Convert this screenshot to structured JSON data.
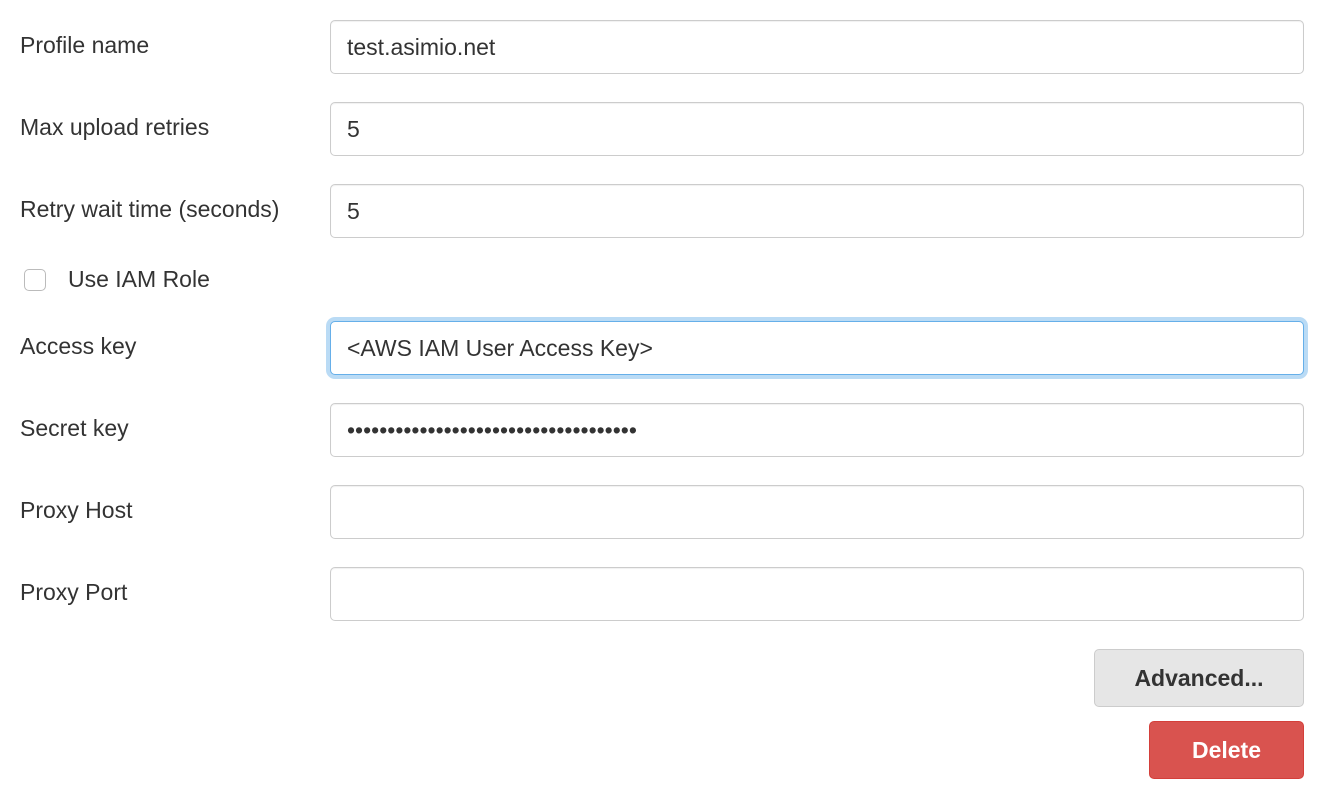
{
  "form": {
    "profile_name": {
      "label": "Profile name",
      "value": "test.asimio.net"
    },
    "max_upload_retries": {
      "label": "Max upload retries",
      "value": "5"
    },
    "retry_wait_time": {
      "label": "Retry wait time (seconds)",
      "value": "5"
    },
    "use_iam_role": {
      "label": "Use IAM Role",
      "checked": false
    },
    "access_key": {
      "label": "Access key",
      "value": "<AWS IAM User Access Key>"
    },
    "secret_key": {
      "label": "Secret key",
      "value": "••••••••••••••••••••••••••••••••••••"
    },
    "proxy_host": {
      "label": "Proxy Host",
      "value": ""
    },
    "proxy_port": {
      "label": "Proxy Port",
      "value": ""
    }
  },
  "buttons": {
    "advanced": "Advanced...",
    "delete": "Delete"
  }
}
